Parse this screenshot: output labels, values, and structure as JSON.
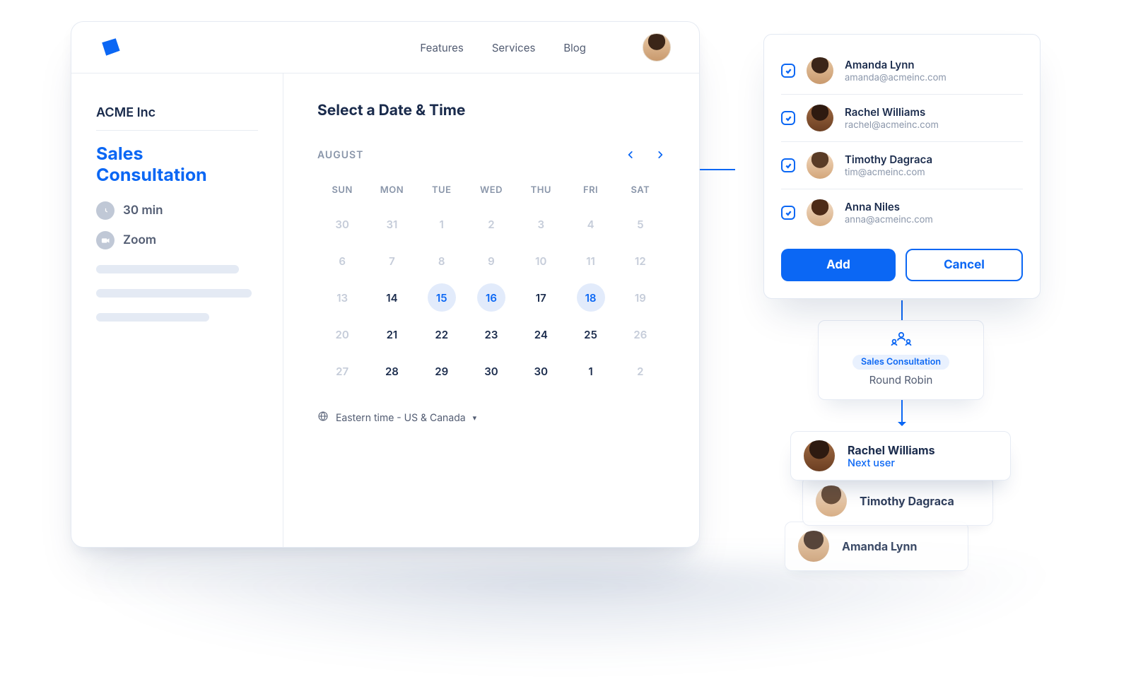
{
  "nav": {
    "items": [
      "Features",
      "Services",
      "Blog"
    ]
  },
  "side": {
    "org": "ACME Inc",
    "title": "Sales Consultation",
    "duration": "30 min",
    "location": "Zoom"
  },
  "main": {
    "heading": "Select a Date & Time",
    "month": "AUGUST",
    "weekdays": [
      "SUN",
      "MON",
      "TUE",
      "WED",
      "THU",
      "FRI",
      "SAT"
    ],
    "weeks": [
      [
        {
          "d": "30",
          "m": true
        },
        {
          "d": "31",
          "m": true
        },
        {
          "d": "1",
          "m": true
        },
        {
          "d": "2",
          "m": true
        },
        {
          "d": "3",
          "m": true
        },
        {
          "d": "4",
          "m": true
        },
        {
          "d": "5",
          "m": true
        }
      ],
      [
        {
          "d": "6",
          "m": true
        },
        {
          "d": "7",
          "m": true
        },
        {
          "d": "8",
          "m": true
        },
        {
          "d": "9",
          "m": true
        },
        {
          "d": "10",
          "m": true
        },
        {
          "d": "11",
          "m": true
        },
        {
          "d": "12",
          "m": true
        }
      ],
      [
        {
          "d": "13",
          "m": true
        },
        {
          "d": "14"
        },
        {
          "d": "15",
          "s": true
        },
        {
          "d": "16",
          "s": true
        },
        {
          "d": "17"
        },
        {
          "d": "18",
          "s": true
        },
        {
          "d": "19",
          "m": true
        }
      ],
      [
        {
          "d": "20",
          "m": true
        },
        {
          "d": "21"
        },
        {
          "d": "22"
        },
        {
          "d": "23"
        },
        {
          "d": "24"
        },
        {
          "d": "25"
        },
        {
          "d": "26",
          "m": true
        }
      ],
      [
        {
          "d": "27",
          "m": true
        },
        {
          "d": "28"
        },
        {
          "d": "29"
        },
        {
          "d": "30"
        },
        {
          "d": "30"
        },
        {
          "d": "1"
        },
        {
          "d": "2",
          "m": true
        }
      ]
    ],
    "tz": "Eastern time - US & Canada"
  },
  "panel": {
    "people": [
      {
        "name": "Amanda Lynn",
        "email": "amanda@acmeinc.com",
        "av": "av1"
      },
      {
        "name": "Rachel Williams",
        "email": "rachel@acmeinc.com",
        "av": "av2"
      },
      {
        "name": "Timothy Dagraca",
        "email": "tim@acmeinc.com",
        "av": "av3"
      },
      {
        "name": "Anna Niles",
        "email": "anna@acmeinc.com",
        "av": "av4"
      }
    ],
    "add": "Add",
    "cancel": "Cancel"
  },
  "rr": {
    "chip": "Sales Consultation",
    "label": "Round Robin"
  },
  "stack": [
    {
      "name": "Rachel Williams",
      "sub": "Next user",
      "av": "av2"
    },
    {
      "name": "Timothy Dagraca",
      "sub": "",
      "av": "av3"
    },
    {
      "name": "Amanda Lynn",
      "sub": "",
      "av": "av1"
    }
  ]
}
